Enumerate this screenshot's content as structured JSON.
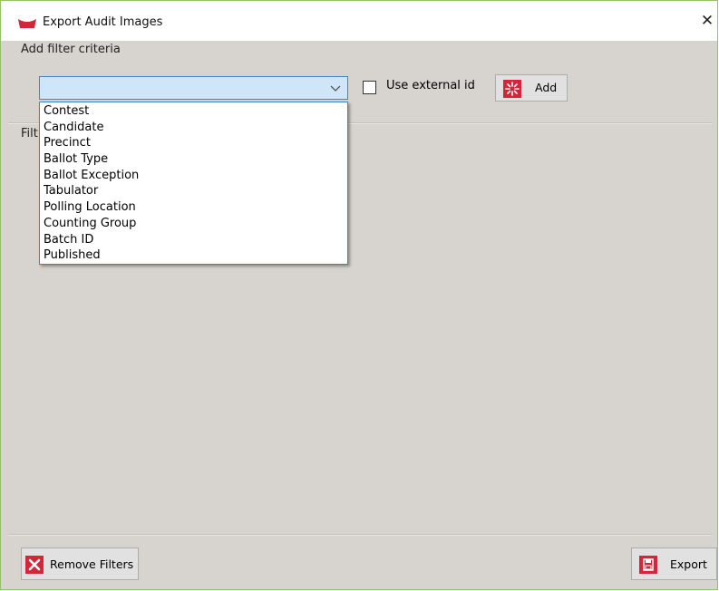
{
  "window": {
    "title": "Export Audit Images",
    "close_glyph": "✕"
  },
  "add_filter": {
    "label": "Add filter criteria",
    "combo_value": "",
    "options": [
      "Contest",
      "Candidate",
      "Precinct",
      "Ballot Type",
      "Ballot Exception",
      "Tabulator",
      "Polling Location",
      "Counting Group",
      "Batch ID",
      "Published"
    ],
    "use_external_id_label": "Use external id",
    "use_external_id_checked": false,
    "add_label": "Add"
  },
  "filters_section": {
    "label_partial": "Filt"
  },
  "footer": {
    "remove_filters_label": "Remove Filters",
    "export_label": "Export"
  },
  "icons": {
    "app": "ballot-logo-icon",
    "combo_arrow": "chevron-down-icon",
    "add": "sparkle-add-icon",
    "remove": "red-x-icon",
    "export": "floppy-disk-icon"
  },
  "colors": {
    "accent_red": "#d0273b",
    "selection_blue": "#cfe6f8",
    "border_blue": "#3e86c9",
    "window_bg": "#d7d3ce"
  }
}
